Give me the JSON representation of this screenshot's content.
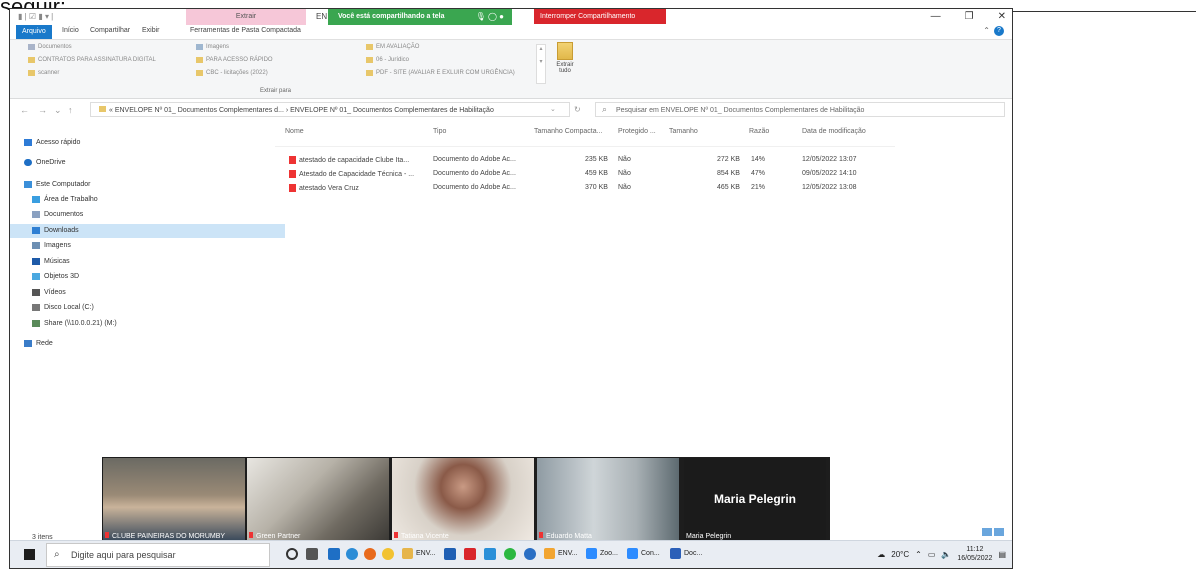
{
  "top_text": "seguir:",
  "titlebar": {
    "context_tab": "Extrair",
    "title_fragment": "EN",
    "share_banner": "Você está compartilhando a tela",
    "stop_share": "Interromper Compartilhamento",
    "minimize": "—",
    "maximize": "❐",
    "close": "✕"
  },
  "tabs": {
    "file": "Arquivo",
    "home": "Início",
    "share": "Compartilhar",
    "view": "Exibir",
    "tools": "Ferramentas de Pasta Compactada"
  },
  "ribbon": {
    "col1": [
      "Documentos",
      "CONTRATOS PARA ASSINATURA DIGITAL",
      "scanner"
    ],
    "col2": [
      "Imagens",
      "PARA ACESSO RÁPIDO",
      "CBC - licitações (2022)"
    ],
    "col3": [
      "EM AVALIAÇÃO",
      "06 - Jurídico",
      "PDF - SITE (AVALIAR E EXLUIR COM URGÊNCIA)"
    ],
    "extract_all": "Extrair tudo",
    "group_label": "Extrair para"
  },
  "address": {
    "path": "« ENVELOPE Nº 01_ Documentos Complementares d... › ENVELOPE Nº 01_ Documentos Complementares de Habilitação",
    "search_placeholder": "Pesquisar em ENVELOPE Nº 01_ Documentos Complementares de Habilitação"
  },
  "sidebar": {
    "items": [
      {
        "label": "Acesso rápido",
        "icon": "star-icon",
        "color": "#2e7bd6"
      },
      {
        "label": "OneDrive",
        "icon": "cloud-icon",
        "color": "#1e6fc5"
      },
      {
        "label": "Este Computador",
        "icon": "computer-icon",
        "color": "#3b8fd9"
      },
      {
        "label": "Área de Trabalho",
        "icon": "desktop-icon",
        "color": "#3a9ee0"
      },
      {
        "label": "Documentos",
        "icon": "documents-icon",
        "color": "#8aa1c1"
      },
      {
        "label": "Downloads",
        "icon": "download-icon",
        "color": "#2f7fd3"
      },
      {
        "label": "Imagens",
        "icon": "images-icon",
        "color": "#6d8fb3"
      },
      {
        "label": "Músicas",
        "icon": "music-icon",
        "color": "#1d5aa8"
      },
      {
        "label": "Objetos 3D",
        "icon": "cube-icon",
        "color": "#4aa8e0"
      },
      {
        "label": "Vídeos",
        "icon": "video-icon",
        "color": "#555555"
      },
      {
        "label": "Disco Local (C:)",
        "icon": "disk-icon",
        "color": "#777777"
      },
      {
        "label": "Share (\\\\10.0.0.21) (M:)",
        "icon": "network-drive-icon",
        "color": "#5a8a5a"
      },
      {
        "label": "Rede",
        "icon": "network-icon",
        "color": "#3a7cc8"
      }
    ],
    "selected": "Downloads",
    "status_count": "3 itens"
  },
  "columns": [
    "Nome",
    "Tipo",
    "Tamanho Compacta...",
    "Protegido ...",
    "Tamanho",
    "Razão",
    "Data de modificação"
  ],
  "files": [
    {
      "name": "atestado de capacidade Clube Ita...",
      "type": "Documento do Adobe Ac...",
      "compressed": "235 KB",
      "protected": "Não",
      "size": "272 KB",
      "ratio": "14%",
      "modified": "12/05/2022 13:07"
    },
    {
      "name": "Atestado de Capacidade Técnica - ...",
      "type": "Documento do Adobe Ac...",
      "compressed": "459 KB",
      "protected": "Não",
      "size": "854 KB",
      "ratio": "47%",
      "modified": "09/05/2022 14:10"
    },
    {
      "name": "atestado Vera Cruz",
      "type": "Documento do Adobe Ac...",
      "compressed": "370 KB",
      "protected": "Não",
      "size": "465 KB",
      "ratio": "21%",
      "modified": "12/05/2022 13:08"
    }
  ],
  "video": {
    "participants": [
      "CLUBE PAINEIRAS DO MORUMBY",
      "Green Partner",
      "Tatiana Vicente",
      "Eduardo Matta",
      "Maria Pelegrin"
    ],
    "featured_name": "Maria Pelegrin"
  },
  "taskbar": {
    "search_placeholder": "Digite aqui para pesquisar",
    "apps": [
      "ENV...",
      "ENV...",
      "Zoo...",
      "Con...",
      "Doc..."
    ],
    "weather": "20°C",
    "time": "11:12",
    "date": "16/05/2022"
  }
}
